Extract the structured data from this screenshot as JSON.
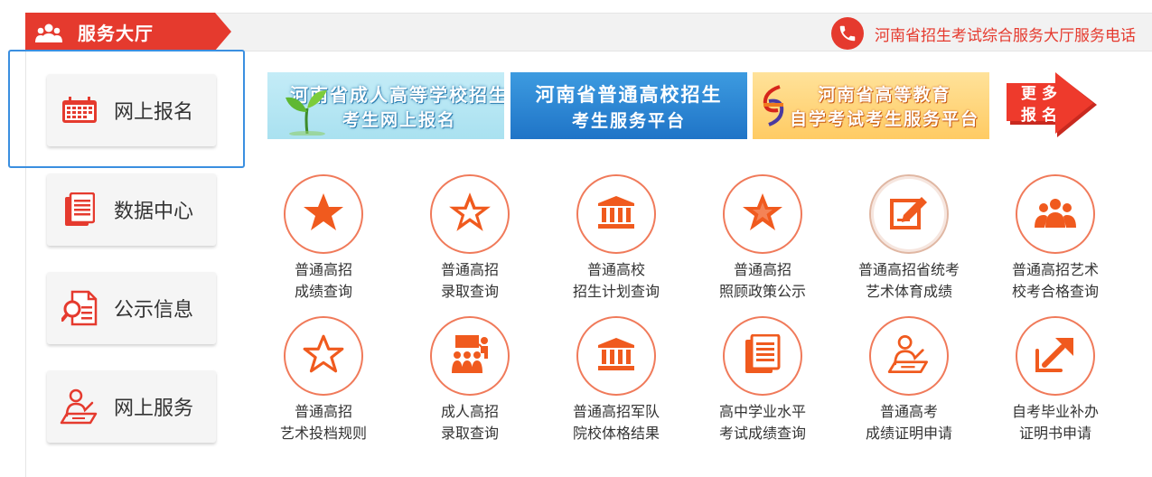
{
  "header": {
    "title": "服务大厅",
    "phone_text": "河南省招生考试综合服务大厅服务电话"
  },
  "colors": {
    "accent": "#e53a2e",
    "icon_orange": "#f05a1e",
    "highlight": "#3b8fe0"
  },
  "sidebar": {
    "items": [
      {
        "label": "网上报名",
        "icon": "calendar-icon"
      },
      {
        "label": "数据中心",
        "icon": "documents-icon"
      },
      {
        "label": "公示信息",
        "icon": "magnifier-document-icon"
      },
      {
        "label": "网上服务",
        "icon": "person-desk-icon"
      }
    ]
  },
  "banners": [
    {
      "line1": "河南省成人高等学校招生",
      "line2": "考生网上报名"
    },
    {
      "line1": "河南省普通高校招生",
      "line2": "考生服务平台"
    },
    {
      "line1": "河南省高等教育",
      "line2": "自学考试考生服务平台"
    }
  ],
  "more": {
    "line1": "更多",
    "line2": "报名"
  },
  "services": [
    {
      "line1": "普通高招",
      "line2": "成绩查询",
      "icon": "star-solid-icon"
    },
    {
      "line1": "普通高招",
      "line2": "录取查询",
      "icon": "star-outline-icon"
    },
    {
      "line1": "普通高校",
      "line2": "招生计划查询",
      "icon": "building-icon"
    },
    {
      "line1": "普通高招",
      "line2": "照顾政策公示",
      "icon": "star-solid-icon"
    },
    {
      "line1": "普通高招省统考",
      "line2": "艺术体育成绩",
      "icon": "edit-icon"
    },
    {
      "line1": "普通高招艺术",
      "line2": "校考合格查询",
      "icon": "group-icon"
    },
    {
      "line1": "普通高招",
      "line2": "艺术投档规则",
      "icon": "star-outline-icon"
    },
    {
      "line1": "成人高招",
      "line2": "录取查询",
      "icon": "presentation-icon"
    },
    {
      "line1": "普通高招军队",
      "line2": "院校体格结果",
      "icon": "building-icon"
    },
    {
      "line1": "高中学业水平",
      "line2": "考试成绩查询",
      "icon": "documents-icon"
    },
    {
      "line1": "普通高考",
      "line2": "成绩证明申请",
      "icon": "person-desk-icon"
    },
    {
      "line1": "自考毕业补办",
      "line2": "证明书申请",
      "icon": "arrow-upright-icon"
    }
  ]
}
